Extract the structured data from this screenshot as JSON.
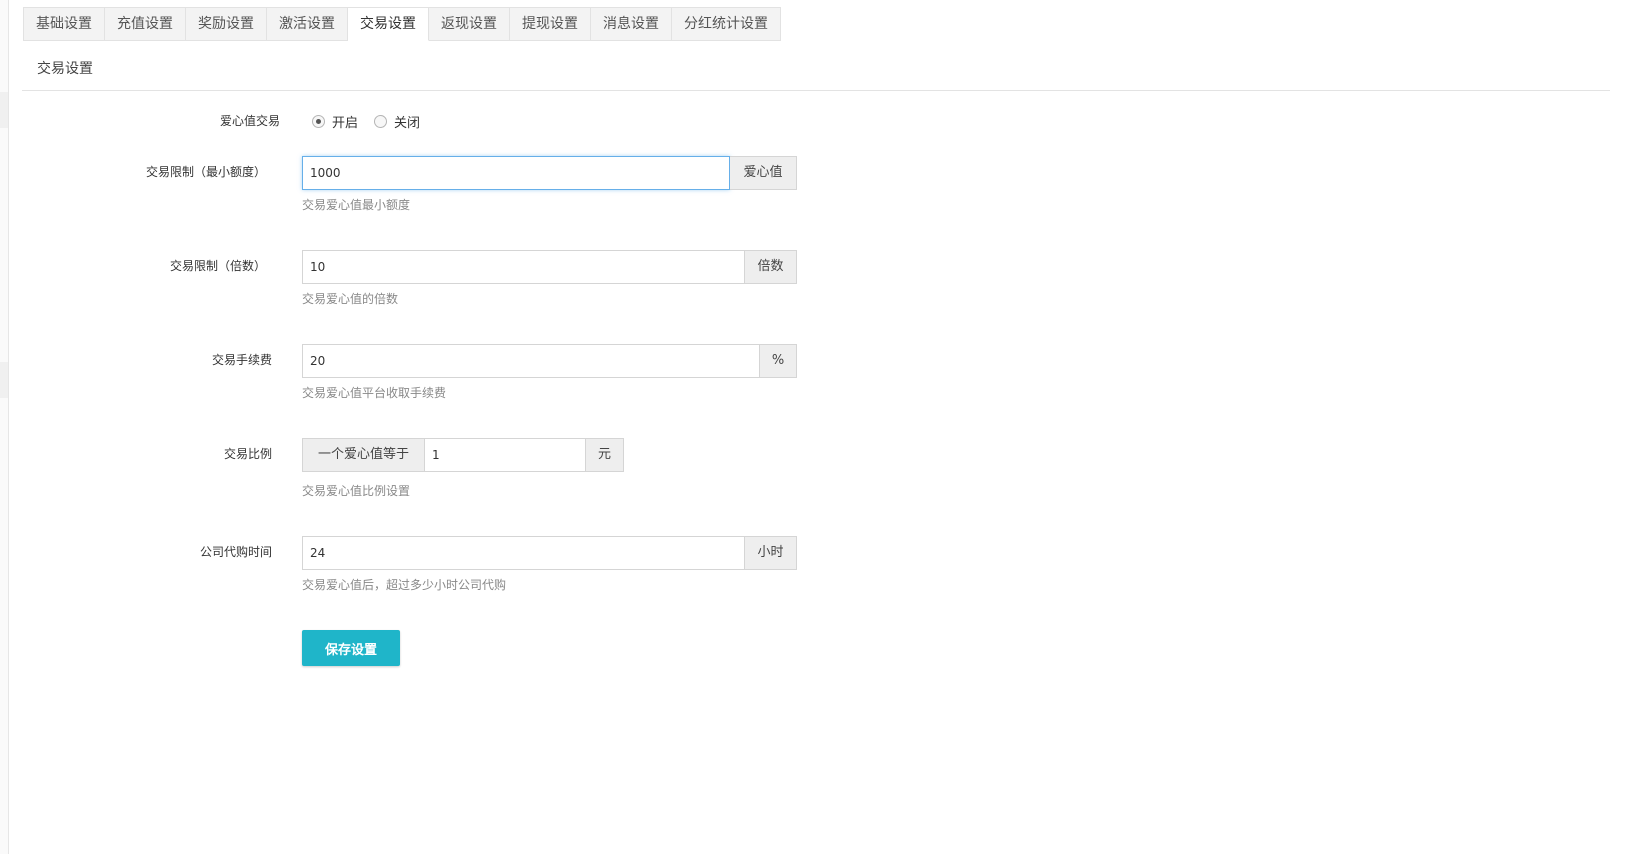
{
  "tabs": [
    {
      "label": "基础设置",
      "active": false
    },
    {
      "label": "充值设置",
      "active": false
    },
    {
      "label": "奖励设置",
      "active": false
    },
    {
      "label": "激活设置",
      "active": false
    },
    {
      "label": "交易设置",
      "active": true
    },
    {
      "label": "返现设置",
      "active": false
    },
    {
      "label": "提现设置",
      "active": false
    },
    {
      "label": "消息设置",
      "active": false
    },
    {
      "label": "分红统计设置",
      "active": false
    }
  ],
  "section_title": "交易设置",
  "form": {
    "love_trade": {
      "label": "爱心值交易",
      "options": [
        {
          "label": "开启",
          "checked": true
        },
        {
          "label": "关闭",
          "checked": false
        }
      ]
    },
    "min_amount": {
      "label": "交易限制（最小额度）",
      "value": "1000",
      "addon": "爱心值",
      "help": "交易爱心值最小额度"
    },
    "multiple": {
      "label": "交易限制（倍数）",
      "value": "10",
      "addon": "倍数",
      "help": "交易爱心值的倍数"
    },
    "fee": {
      "label": "交易手续费",
      "value": "20",
      "addon": "%",
      "help": "交易爱心值平台收取手续费"
    },
    "ratio": {
      "label": "交易比例",
      "prefix": "一个爱心值等于",
      "value": "1",
      "addon": "元",
      "help": "交易爱心值比例设置"
    },
    "buyback_time": {
      "label": "公司代购时间",
      "value": "24",
      "addon": "小时",
      "help": "交易爱心值后，超过多少小时公司代购"
    },
    "save_label": "保存设置"
  },
  "colors": {
    "primary_button": "#1fb5c9",
    "focus_border": "#66afe9"
  }
}
